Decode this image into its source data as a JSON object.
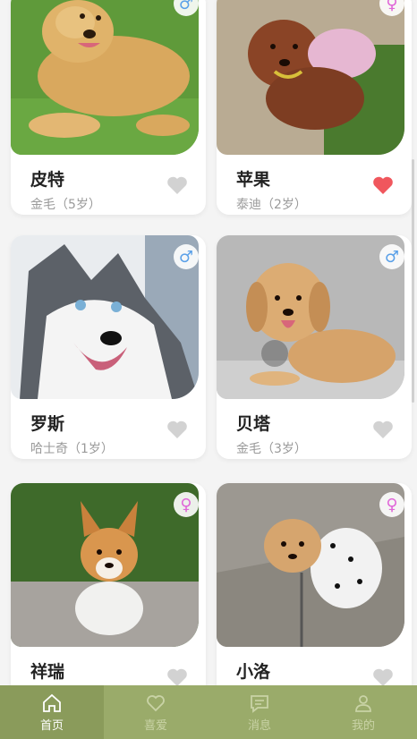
{
  "pets": [
    {
      "name": "皮特",
      "breed": "金毛（5岁）",
      "gender": "male",
      "gender_icon": "♂",
      "liked": false,
      "photo": "golden-retriever-adult"
    },
    {
      "name": "苹果",
      "breed": "泰迪（2岁）",
      "gender": "female",
      "gender_icon": "♀",
      "liked": true,
      "photo": "brown-poodle"
    },
    {
      "name": "罗斯",
      "breed": "哈士奇（1岁）",
      "gender": "male",
      "gender_icon": "♂",
      "liked": false,
      "photo": "husky"
    },
    {
      "name": "贝塔",
      "breed": "金毛（3岁）",
      "gender": "male",
      "gender_icon": "♂",
      "liked": false,
      "photo": "golden-puppy"
    },
    {
      "name": "祥瑞",
      "breed": "",
      "gender": "female",
      "gender_icon": "♀",
      "liked": false,
      "photo": "corgi"
    },
    {
      "name": "小洛",
      "breed": "",
      "gender": "female",
      "gender_icon": "♀",
      "liked": false,
      "photo": "poodle-in-coat"
    }
  ],
  "tabbar": {
    "items": [
      {
        "label": "首页",
        "icon": "home-icon",
        "active": true
      },
      {
        "label": "喜爱",
        "icon": "heart-icon",
        "active": false
      },
      {
        "label": "消息",
        "icon": "message-icon",
        "active": false
      },
      {
        "label": "我的",
        "icon": "user-icon",
        "active": false
      }
    ]
  },
  "colors": {
    "tabbar_bg": "#9aab6a",
    "tab_active_bg": "#8a9b5b",
    "liked_heart": "#f0575d",
    "unliked_heart": "#d2d2d2",
    "male": "#5aa0e8",
    "female": "#e066d8"
  }
}
